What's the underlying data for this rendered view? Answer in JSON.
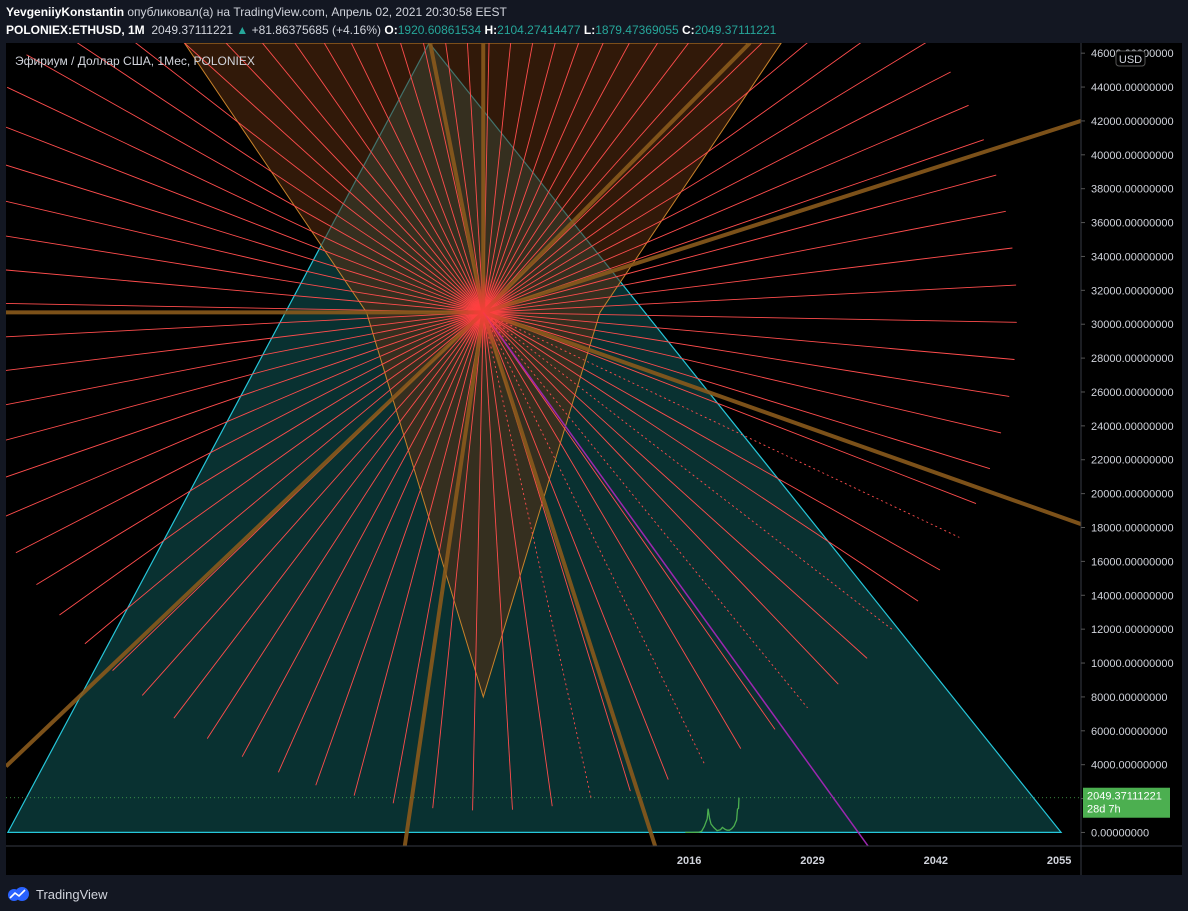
{
  "header": {
    "author": "YevgeniiyKonstantin",
    "published_text": "опубликовал(а) на TradingView.com, Апрель 02, 2021 20:30:58 EEST",
    "symbol": "POLONIEX:ETHUSD, 1M",
    "last_price": "2049.37111221",
    "change_arrow": "▲",
    "change": "+81.86375685 (+4.16%)",
    "open_label": "O:",
    "open": "1920.60861534",
    "high_label": "H:",
    "high": "2104.27414477",
    "low_label": "L:",
    "low": "1879.47369055",
    "close_label": "C:",
    "close": "2049.37111221"
  },
  "chart_title": "Эфириум / Доллар США, 1Мес, POLONIEX",
  "currency_badge": "USD",
  "price_badge": {
    "value": "2049.37111221",
    "countdown": "28d 7h"
  },
  "footer": {
    "brand": "TradingView"
  },
  "colors": {
    "background": "#000000",
    "triangle_stroke": "#26c6da",
    "triangle_fill": "#0b3a3a",
    "rays": "#ff4d4d",
    "thick_rays": "#8a5a1c",
    "diamond_fill": "#5a2e10",
    "diamond_stroke": "#c8822a",
    "price_line": "#4caf50",
    "badge": "#4caf50",
    "purple": "#9c27b0"
  },
  "chart_data": {
    "type": "line",
    "title": "Эфириум / Доллар США, 1Мес, POLONIEX",
    "y_ticks": [
      "0.00000000",
      "2000.00000000",
      "4000.00000000",
      "6000.00000000",
      "8000.00000000",
      "10000.00000000",
      "12000.00000000",
      "14000.00000000",
      "16000.00000000",
      "18000.00000000",
      "20000.00000000",
      "22000.00000000",
      "24000.00000000",
      "26000.00000000",
      "28000.00000000",
      "30000.00000000",
      "32000.00000000",
      "34000.00000000",
      "36000.00000000",
      "38000.00000000",
      "40000.00000000",
      "42000.00000000",
      "44000.00000000",
      "46000.00000000"
    ],
    "x_ticks": [
      "2016",
      "2029",
      "2042",
      "2055"
    ],
    "ylim": [
      -800,
      46600
    ],
    "xlim": [
      1944,
      2057.3
    ],
    "series": [
      {
        "values": [
          [
            2015.6,
            0
          ],
          [
            2016.0,
            1
          ],
          [
            2016.5,
            10
          ],
          [
            2017.0,
            15
          ],
          [
            2017.3,
            60
          ],
          [
            2017.6,
            350
          ],
          [
            2017.9,
            800
          ],
          [
            2018.0,
            1400
          ],
          [
            2018.15,
            860
          ],
          [
            2018.3,
            500
          ],
          [
            2018.6,
            290
          ],
          [
            2018.95,
            110
          ],
          [
            2019.3,
            165
          ],
          [
            2019.5,
            300
          ],
          [
            2019.8,
            180
          ],
          [
            2020.0,
            130
          ],
          [
            2020.25,
            135
          ],
          [
            2020.5,
            230
          ],
          [
            2020.75,
            390
          ],
          [
            2020.9,
            600
          ],
          [
            2021.0,
            730
          ],
          [
            2021.1,
            1380
          ],
          [
            2021.2,
            1420
          ],
          [
            2021.25,
            2049
          ]
        ]
      }
    ],
    "overlays": {
      "triangle": [
        [
          1944.2,
          0
        ],
        [
          1988.6,
          46600
        ],
        [
          2055.2,
          0
        ]
      ],
      "diamond": [
        [
          1962.8,
          46600
        ],
        [
          2025.7,
          46600
        ],
        [
          2006.6,
          30700
        ],
        [
          1994.3,
          8000
        ],
        [
          1982.0,
          30700
        ]
      ],
      "star_center": [
        1994.3,
        30700
      ],
      "thick_ray_ends": [
        [
          1944.0,
          30700
        ],
        [
          2057.3,
          42000
        ],
        [
          2057.3,
          18200
        ],
        [
          1944.0,
          3900
        ],
        [
          1985.9,
          -1300
        ],
        [
          2022.4,
          46600
        ],
        [
          2012.7,
          -1300
        ],
        [
          1988.7,
          46600
        ],
        [
          1994.3,
          46600
        ]
      ],
      "purple_ray_end": [
        2035.5,
        -1300
      ],
      "thin_ray_length": 30000,
      "thin_ray_count": 84
    },
    "last_price": 2049.37111221,
    "legend": "none",
    "grid": false
  }
}
